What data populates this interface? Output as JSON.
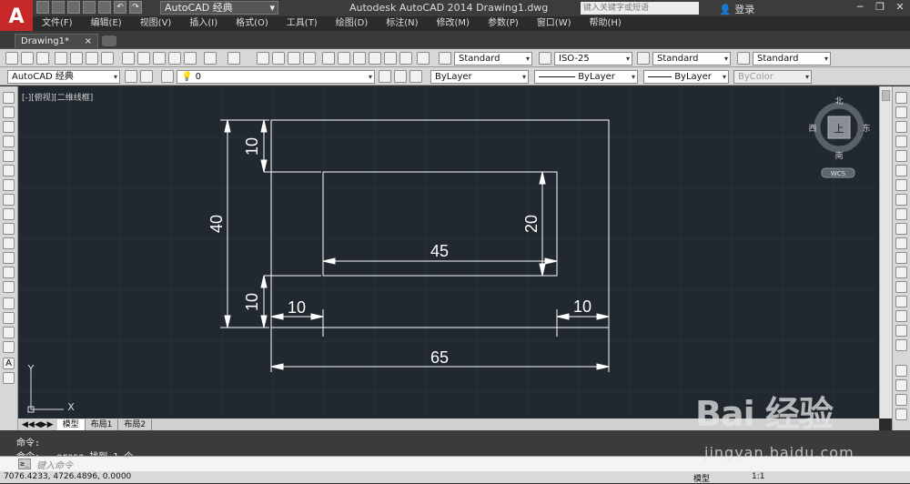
{
  "app": {
    "logo": "A",
    "title": "Autodesk AutoCAD 2014    Drawing1.dwg",
    "workspace": "AutoCAD 经典",
    "search_placeholder": "键入关键字或短语",
    "login": "登录"
  },
  "menu": [
    "文件(F)",
    "编辑(E)",
    "视图(V)",
    "插入(I)",
    "格式(O)",
    "工具(T)",
    "绘图(D)",
    "标注(N)",
    "修改(M)",
    "参数(P)",
    "窗口(W)",
    "帮助(H)"
  ],
  "tab": {
    "label": "Drawing1*",
    "close": "×"
  },
  "toolbar": {
    "text_style": "Standard",
    "dim_style": "ISO-25",
    "table_style": "Standard",
    "mleader_style": "Standard",
    "workspace2": "AutoCAD 经典",
    "layer": "0",
    "color": "ByLayer",
    "linetype": "ByLayer",
    "lineweight": "ByLayer",
    "plotstyle": "ByColor"
  },
  "viewport": {
    "label": "[-][俯视][二维线框]",
    "viewcube": {
      "north": "北",
      "south": "南",
      "east": "东",
      "west": "西",
      "top": "上",
      "wcs": "WCS"
    },
    "ucs": {
      "x": "X",
      "y": "Y"
    }
  },
  "drawing": {
    "dims": {
      "d40": "40",
      "d10a": "10",
      "d10b": "10",
      "d10c": "10",
      "d10d": "10",
      "d20": "20",
      "d45": "45",
      "d65": "65"
    }
  },
  "layout_tabs": [
    "模型",
    "布局1",
    "布局2"
  ],
  "command": {
    "history": [
      "命令:",
      "命令: _.erase 找到 1 个"
    ],
    "placeholder": "键入命令"
  },
  "status": {
    "coords": "7076.4233, 4726.4896, 0.0000",
    "model": "模型",
    "scale": "1:1"
  },
  "watermark": {
    "brand": "Bai 经验",
    "url": "jingyan.baidu.com"
  }
}
